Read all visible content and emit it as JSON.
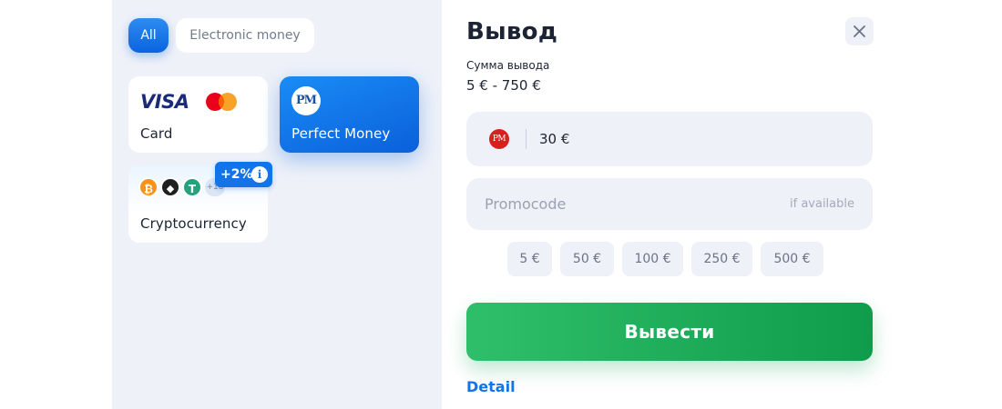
{
  "filters": {
    "all_label": "All",
    "electronic_label": "Electronic money"
  },
  "methods": {
    "card": {
      "label": "Card",
      "visa_text": "VISA",
      "icon": "mastercard-icon"
    },
    "perfect_money": {
      "label": "Perfect Money",
      "logo_text": "PM"
    },
    "crypto": {
      "label": "Cryptocurrency",
      "coins": [
        "₿",
        "◆",
        "T"
      ],
      "more": "+18",
      "bonus": "+2%",
      "bonus_info": "i"
    }
  },
  "withdraw": {
    "title": "Вывод",
    "sum_label": "Сумма вывода",
    "sum_range": "5 € - 750 €",
    "amount_logo": "PM",
    "amount_value": "30 €",
    "promo_placeholder": "Promocode",
    "promo_hint": "if available",
    "presets": [
      "5 €",
      "50 €",
      "100 €",
      "250 €",
      "500 €"
    ],
    "submit_label": "Вывести",
    "detail_label": "Detail"
  },
  "colors": {
    "accent_blue": "#1274e8",
    "submit_green": "#1aa955",
    "panel_bg": "#eef1f8"
  }
}
